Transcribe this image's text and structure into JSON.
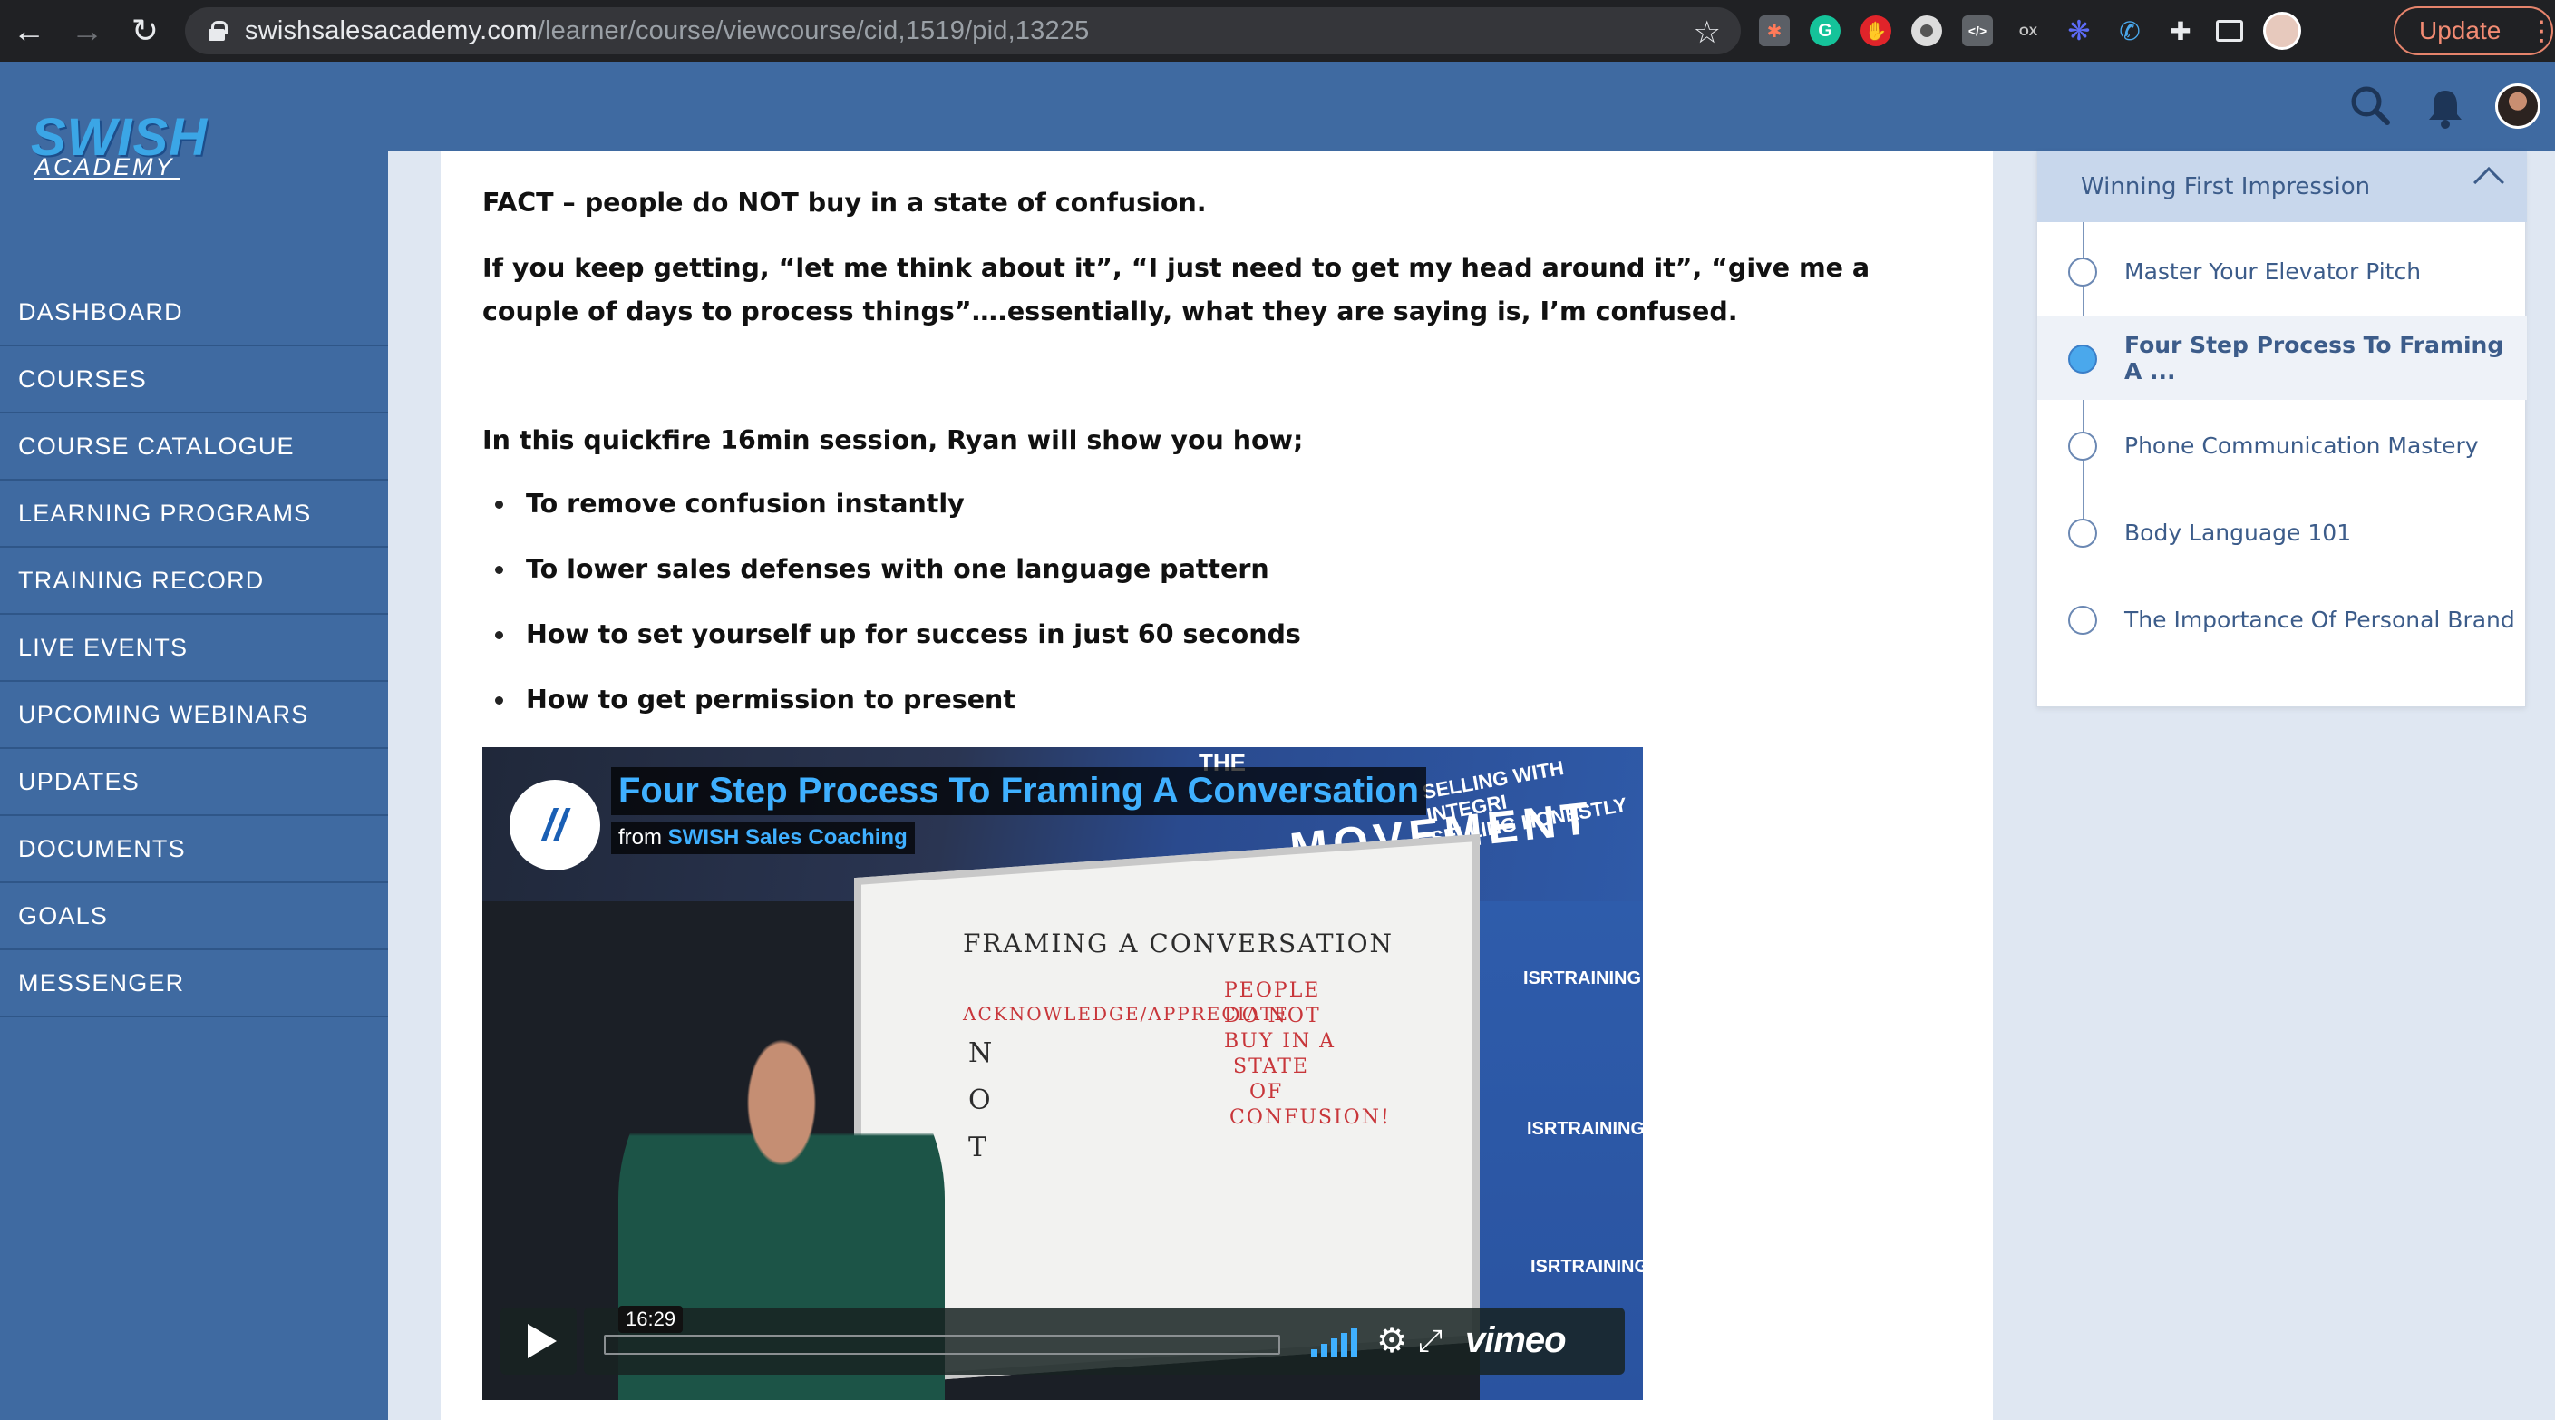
{
  "browser": {
    "url_host": "swishsalesacademy.com",
    "url_path": "/learner/course/viewcourse/cid,1519/pid,13225",
    "update_label": "Update",
    "extensions": [
      "hubspot-icon",
      "grammarly-icon",
      "adblock-icon",
      "record-icon",
      "code-icon",
      "ox-icon",
      "snowflake-icon",
      "phone-icon",
      "puzzle-icon",
      "cast-icon"
    ],
    "ext_labels": {
      "ox": "OX",
      "code": "</>"
    }
  },
  "sidebar": {
    "logo_main": "SWISH",
    "logo_sub": "ACADEMY",
    "items": [
      {
        "label": "DASHBOARD"
      },
      {
        "label": "COURSES"
      },
      {
        "label": "COURSE CATALOGUE"
      },
      {
        "label": "LEARNING PROGRAMS"
      },
      {
        "label": "TRAINING RECORD"
      },
      {
        "label": "LIVE EVENTS"
      },
      {
        "label": "UPCOMING WEBINARS"
      },
      {
        "label": "UPDATES"
      },
      {
        "label": "DOCUMENTS"
      },
      {
        "label": "GOALS"
      },
      {
        "label": "MESSENGER"
      }
    ]
  },
  "content": {
    "fact": "FACT – people do NOT buy in a state of confusion.",
    "paragraph": "If you keep getting, “let me think about it”, “I just need to get my head around it”, “give me a couple of days to process things”….essentially, what they are saying is, I’m confused.",
    "intro": "In this quickfire 16min session, Ryan will show you how;",
    "bullets": [
      "To remove confusion instantly",
      "To lower sales defenses with one language pattern",
      "How to set yourself up for success in just 60 seconds",
      "How to get permission to present"
    ]
  },
  "video": {
    "title": "Four Step Process To Framing A Conversation",
    "from_label": "from",
    "channel": "SWISH Sales Coaching",
    "duration": "16:29",
    "player_brand": "vimeo",
    "banner_movement": "MOVEMENT",
    "banner_integrity_1": "SELLING WITH INTEGRI",
    "banner_integrity_2": "SELLING HONESTLY",
    "banner_the": "THE",
    "board_title": "FRAMING A CONVERSATION",
    "board_acknowledge": "ACKNOWLEDGE/APPRECIATE",
    "board_letters": [
      "N",
      "O",
      "T"
    ],
    "board_red": [
      "PEOPLE",
      "DO NOT",
      "BUY IN A",
      "STATE",
      "OF",
      "CONFUSION!"
    ],
    "wall_brand": "ISRTRAINING",
    "volume_level": 0.9
  },
  "right_panel": {
    "section_title": "Winning First Impression",
    "lessons": [
      {
        "label": "Master Your Elevator Pitch",
        "active": false
      },
      {
        "label": "Four Step Process To Framing A ...",
        "active": true
      },
      {
        "label": "Phone Communication Mastery",
        "active": false
      },
      {
        "label": "Body Language 101",
        "active": false
      },
      {
        "label": "The Importance Of Personal Brand",
        "active": false
      }
    ]
  },
  "colors": {
    "sidebar_bg": "#3f6aa1",
    "content_bg": "#dfe7f2",
    "accent_blue": "#4aa8ec",
    "vimeo_blue": "#3fb0ff"
  }
}
